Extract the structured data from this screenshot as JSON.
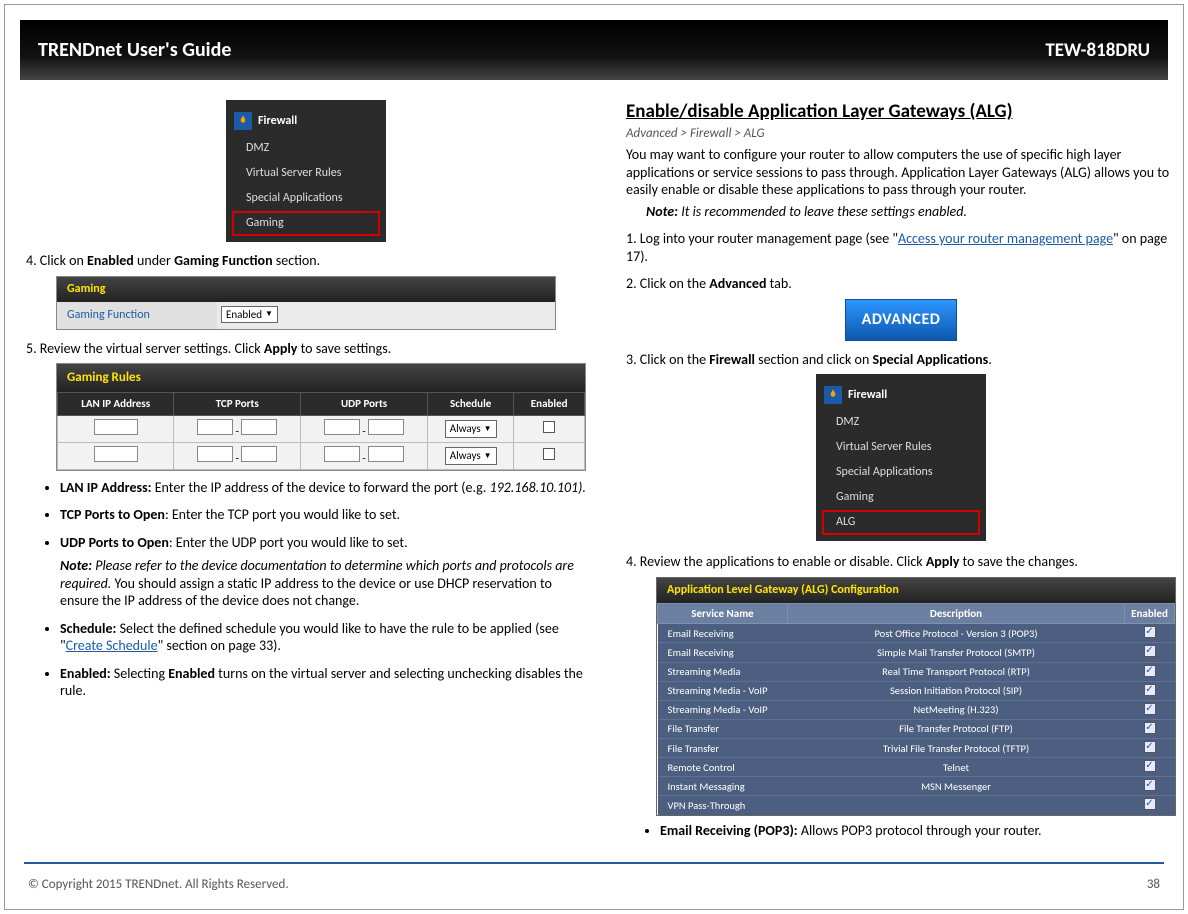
{
  "header": {
    "left": "TRENDnet User's Guide",
    "right": "TEW-818DRU"
  },
  "left": {
    "fw_title": "Firewall",
    "fw_items": [
      "DMZ",
      "Virtual Server Rules",
      "Special Applications",
      "Gaming"
    ],
    "step4": "4. Click on ",
    "step4_bold1": "Enabled",
    "step4_mid": " under ",
    "step4_bold2": "Gaming Function",
    "step4_end": " section.",
    "gaming_head": "Gaming",
    "gaming_label": "Gaming Function",
    "gaming_value": "Enabled",
    "step5": "5. Review the virtual server settings. Click ",
    "step5_bold": "Apply",
    "step5_end": " to save settings.",
    "rules_head": "Gaming Rules",
    "rules_cols": [
      "LAN IP Address",
      "TCP Ports",
      "UDP Ports",
      "Schedule",
      "Enabled"
    ],
    "rules_sched": "Always",
    "bullets": [
      {
        "b": "LAN IP Address:",
        "t": " Enter the IP address of the device to forward the port (e.g. ",
        "ital": "192.168.10.101).",
        "tail": ""
      },
      {
        "b": "TCP Ports to Open",
        "t": ": Enter the TCP port you would like to set."
      },
      {
        "b": "UDP Ports to Open",
        "t": ": Enter the UDP port you would like to set."
      },
      {
        "note_b": "Note:",
        "note_i": " Please refer to the device documentation to determine which ports and protocols are required.",
        "t": " You should assign a static IP address to the device or use DHCP reservation to ensure the IP address of the device does not change."
      },
      {
        "b": "Schedule:",
        "t": " Select the defined schedule you would like to have the rule to be applied (see \"",
        "link": "Create Schedule",
        "tail": "\" section on page 33)."
      },
      {
        "b": "Enabled:",
        "t": " Selecting ",
        "b2": "Enabled",
        "t2": " turns on the virtual server and selecting unchecking disables the rule."
      }
    ]
  },
  "right": {
    "title": "Enable/disable Application Layer Gateways (ALG)",
    "breadcrumb": "Advanced > Firewall > ALG",
    "para": "You may want to configure your router to allow computers the use of specific high layer applications or service sessions to pass through. Application Layer Gateways (ALG) allows you to easily enable or disable these applications to pass through your router.",
    "note_b": "Note:",
    "note_i": " It is recommended to leave these settings enabled.",
    "step1a": "1. Log into your router management page (see \"",
    "step1_link": "Access your router management page",
    "step1b": "\" on page 17).",
    "step2a": "2. Click on the ",
    "step2_b": "Advanced",
    "step2b": " tab.",
    "adv_label": "ADVANCED",
    "step3a": "3.  Click on the ",
    "step3_b1": "Firewall",
    "step3_mid": " section and click on ",
    "step3_b2": "Special Applications",
    "step3_end": ".",
    "fw2_items": [
      "DMZ",
      "Virtual Server Rules",
      "Special Applications",
      "Gaming",
      "ALG"
    ],
    "step4a": "4. Review the applications to enable or disable. Click ",
    "step4_b": "Apply",
    "step4b": " to save the changes.",
    "alg_head": "Application Level Gateway (ALG) Configuration",
    "alg_cols": [
      "Service Name",
      "Description",
      "Enabled"
    ],
    "alg_rows": [
      {
        "name": "Email Receiving",
        "desc": "Post Office Protocol - Version 3 (POP3)"
      },
      {
        "name": "Email Receiving",
        "desc": "Simple Mail Transfer Protocol (SMTP)"
      },
      {
        "name": "Streaming Media",
        "desc": "Real Time Transport Protocol (RTP)"
      },
      {
        "name": "Streaming Media - VoIP",
        "desc": "Session Initiation Protocol (SIP)"
      },
      {
        "name": "Streaming Media - VoIP",
        "desc": "NetMeeting (H.323)"
      },
      {
        "name": "File Transfer",
        "desc": "File Transfer Protocol (FTP)"
      },
      {
        "name": "File Transfer",
        "desc": "Trivial File Transfer Protocol (TFTP)"
      },
      {
        "name": "Remote Control",
        "desc": "Telnet"
      },
      {
        "name": "Instant Messaging",
        "desc": "MSN Messenger"
      },
      {
        "name": "VPN Pass-Through",
        "desc": ""
      }
    ],
    "bullet_b": "Email Receiving (POP3):",
    "bullet_t": " Allows POP3 protocol through your router."
  },
  "footer": {
    "copyright": "© Copyright 2015 TRENDnet. All Rights Reserved.",
    "page": "38"
  }
}
